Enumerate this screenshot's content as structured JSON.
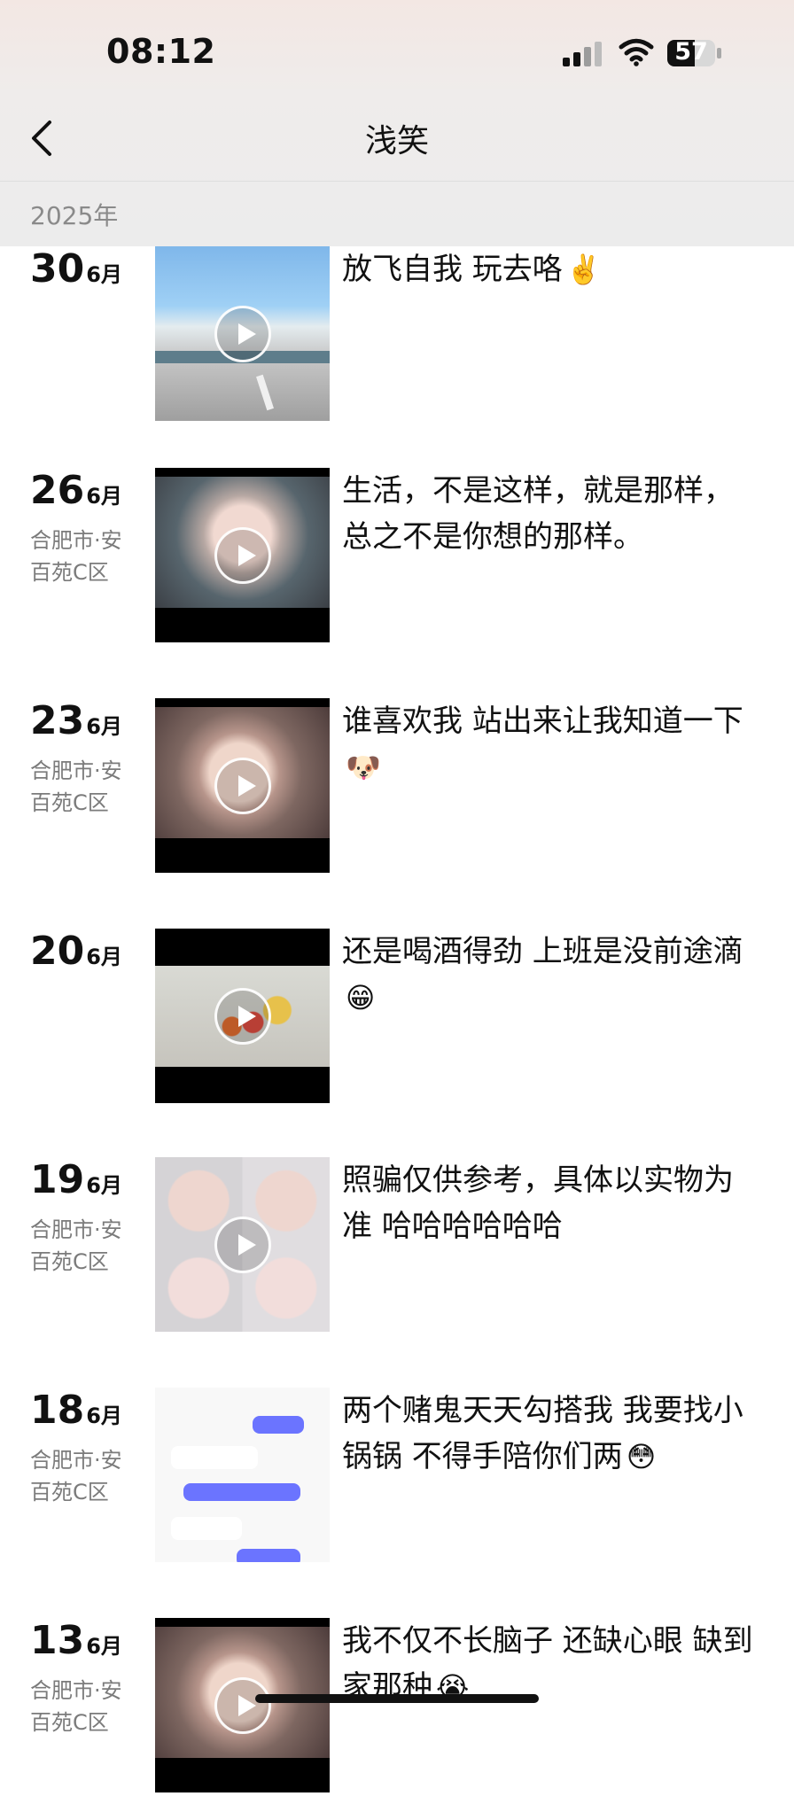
{
  "status_bar": {
    "time": "08:12",
    "battery": "57"
  },
  "nav": {
    "title": "浅笑",
    "year": "2025年"
  },
  "posts": [
    {
      "day": "30",
      "month": "6月",
      "location_line1": "",
      "location_line2": "",
      "caption": "放飞自我 玩去咯",
      "emoji": "✌️"
    },
    {
      "day": "26",
      "month": "6月",
      "location_line1": "合肥市·安",
      "location_line2": "百苑C区",
      "caption": "生活，不是这样，就是那样，总之不是你想的那样。",
      "emoji": ""
    },
    {
      "day": "23",
      "month": "6月",
      "location_line1": "合肥市·安",
      "location_line2": "百苑C区",
      "caption": "谁喜欢我 站出来让我知道一下",
      "emoji": "🐶"
    },
    {
      "day": "20",
      "month": "6月",
      "location_line1": "",
      "location_line2": "",
      "caption": "还是喝酒得劲 上班是没前途滴",
      "emoji": "😁"
    },
    {
      "day": "19",
      "month": "6月",
      "location_line1": "合肥市·安",
      "location_line2": "百苑C区",
      "caption": "照骗仅供参考，具体以实物为准 哈哈哈哈哈哈",
      "emoji": ""
    },
    {
      "day": "18",
      "month": "6月",
      "location_line1": "合肥市·安",
      "location_line2": "百苑C区",
      "caption": "两个赌鬼天天勾搭我 我要找小锅锅 不得手陪你们两",
      "emoji": "😳"
    },
    {
      "day": "13",
      "month": "6月",
      "location_line1": "合肥市·安",
      "location_line2": "百苑C区",
      "caption": "我不仅不长脑子 还缺心眼 缺到家那种",
      "emoji": "😭"
    }
  ]
}
